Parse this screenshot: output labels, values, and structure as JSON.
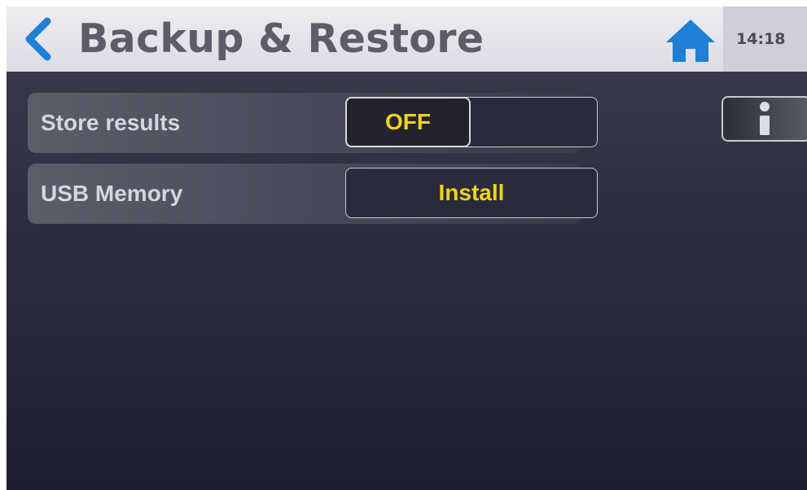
{
  "header": {
    "title": "Backup & Restore",
    "back_icon": "chevron-left-icon",
    "home_icon": "home-icon",
    "clock": "14:18"
  },
  "settings": [
    {
      "label": "Store results",
      "control": "toggle",
      "value": "OFF"
    },
    {
      "label": "USB Memory",
      "control": "button",
      "value": "Install"
    }
  ],
  "info_button": {
    "icon": "info-icon"
  },
  "colors": {
    "accent_blue": "#1f7fd4",
    "value_yellow": "#f1d21a",
    "title_gray": "#5c5d68"
  }
}
